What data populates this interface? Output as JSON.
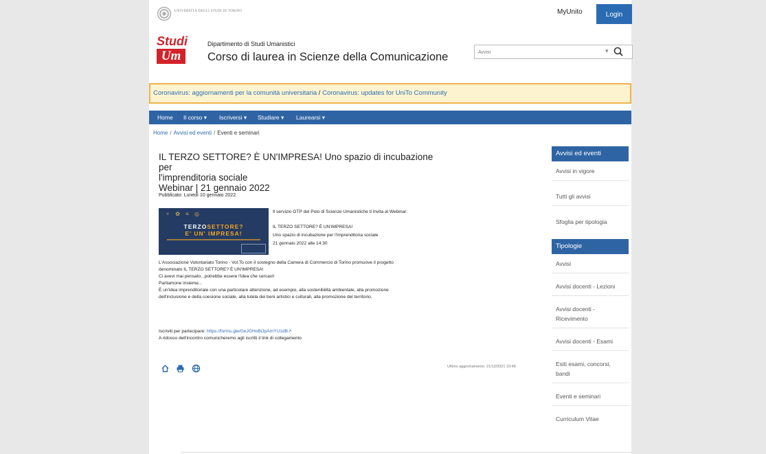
{
  "header": {
    "university_name": "UNIVERSITÀ DEGLI STUDI DI TORINO",
    "myunito": "MyUnito",
    "login": "Login",
    "department": "Dipartimento di Studi Umanistici",
    "course": "Corso di laurea in Scienze della Comunicazione",
    "logo_top": "Studi",
    "logo_bottom": "Um",
    "search_placeholder": "Avvisi"
  },
  "alert": {
    "text1": "Coronavirus: aggiornamenti per la comunità universitaria",
    "sep": " / ",
    "text2": "Coronavirus: updates for UniTo Community"
  },
  "nav": [
    {
      "label": "Home"
    },
    {
      "label": "Il corso ▾"
    },
    {
      "label": "Iscriversi ▾"
    },
    {
      "label": "Studiare ▾"
    },
    {
      "label": "Laurearsi ▾"
    }
  ],
  "breadcrumb": {
    "home": "Home",
    "avvisi": "Avvisi ed eventi",
    "current": "Eventi e seminari"
  },
  "article": {
    "title_line1": "IL TERZO SETTORE? È UN'IMPRESA! Uno spazio di incubazione per",
    "title_line2": "l'imprenditoria sociale",
    "title_line3": "Webinar | 21 gennaio 2022",
    "published": "Pubblicato: Lunedì 10 gennaio 2022",
    "banner_line1a": "TERZO",
    "banner_line1b": "SETTORE?",
    "banner_line2": "E' UN' IMPRESA!",
    "intro1": "Il servizio OTP del Polo di Scienze Umanistiche ti invita al Webinar:",
    "intro2": "IL TERZO SETTORE? È UN'IMPRESA!",
    "intro3": "Uno spazio di incubazione per l'imprenditoria sociale",
    "intro4": "21 gennaio 2022 alle 14.30",
    "p1": "L'Associazione Volontariato Torino - Vol.To con il sostegno della Camera di Commercio di Torino promuove il progetto",
    "p2": "denominato IL TERZO SETTORE? È UN'IMPRESA!",
    "p3": "Ci avevi mai pensato...potrebbe essere l'idea che cercavi!",
    "p4": "Parliamone insieme...",
    "p5": "È un'idea imprenditoriale con una particolare attenzione, ad esempio, alla sostenibilità ambientale, alla promozione",
    "p6": "dell'inclusione e della coesione sociale, alla tutela dei beni artistici e culturali, alla promozione del territorio.",
    "reg_label": "Iscriviti per partecipare: ",
    "reg_link": "https://forms.gle/GeJGHoBiJpAmYU1dB",
    "reg_note": "A ridosso dell'incontro comunicheremo agli iscritti il link di collegamento",
    "updated": "Ultimo aggiornamento: 21/12/2021 10:48"
  },
  "sidebar": {
    "head1": "Avvisi ed eventi",
    "items1": [
      "Avvisi in vigore",
      "Tutti gli avvisi",
      "Sfoglia per tipologia"
    ],
    "head2": "Tipologie",
    "items2": [
      "Avvisi",
      "Avvisi docenti - Lezioni",
      "Avvisi docenti - Ricevimento",
      "Avvisi docenti - Esami",
      "Esiti esami, concorsi, bandi",
      "Eventi e seminari",
      "Curriculum Vitae"
    ]
  },
  "colors": {
    "accent": "#2f64a4",
    "brand_red": "#d2232a",
    "alert_border": "#f0b24b"
  }
}
